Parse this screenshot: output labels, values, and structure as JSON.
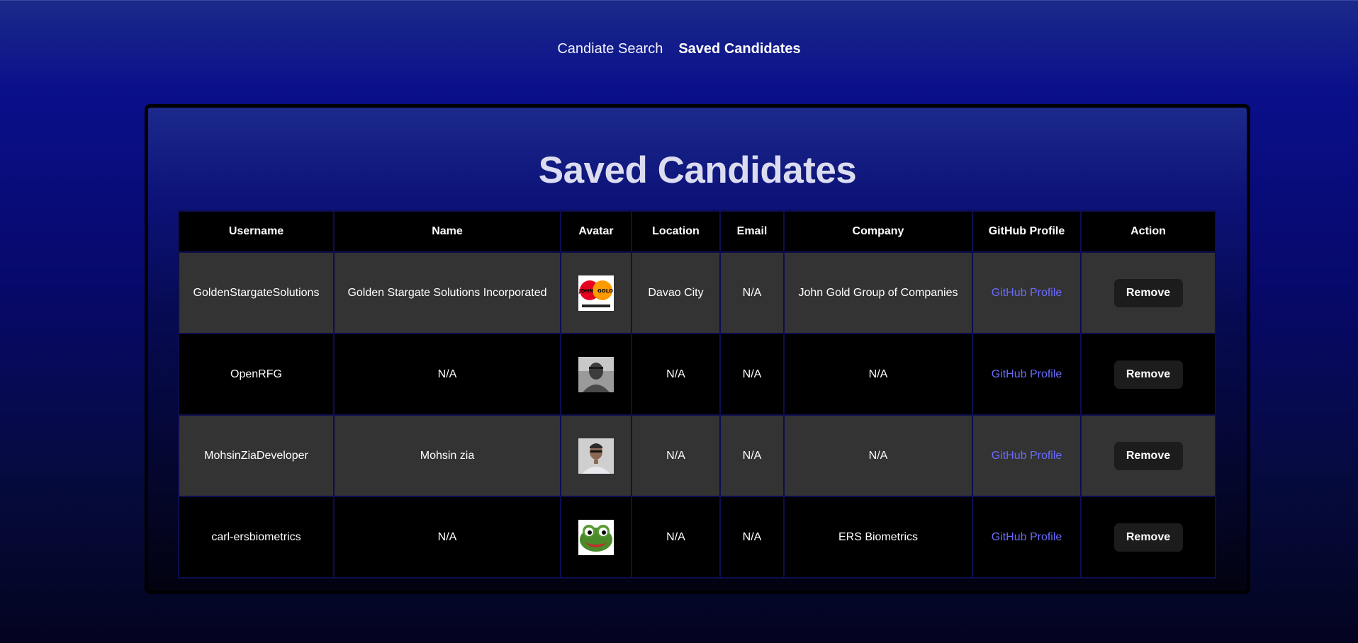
{
  "nav": {
    "search_label": "Candiate Search",
    "saved_label": "Saved Candidates"
  },
  "page": {
    "title": "Saved Candidates"
  },
  "table": {
    "headers": {
      "username": "Username",
      "name": "Name",
      "avatar": "Avatar",
      "location": "Location",
      "email": "Email",
      "company": "Company",
      "github": "GitHub Profile",
      "action": "Action"
    },
    "rows": [
      {
        "username": "GoldenStargateSolutions",
        "name": "Golden Stargate Solutions Incorporated",
        "avatar_icon": "john-gold-logo-avatar",
        "location": "Davao City",
        "email": "N/A",
        "company": "John Gold Group of Companies",
        "github_label": "GitHub Profile",
        "action_label": "Remove",
        "avatar_text_left": "JOHN",
        "avatar_text_right": "GOLD"
      },
      {
        "username": "OpenRFG",
        "name": "N/A",
        "avatar_icon": "person-photo-avatar",
        "location": "N/A",
        "email": "N/A",
        "company": "N/A",
        "github_label": "GitHub Profile",
        "action_label": "Remove"
      },
      {
        "username": "MohsinZiaDeveloper",
        "name": "Mohsin zia",
        "avatar_icon": "person-photo-avatar",
        "location": "N/A",
        "email": "N/A",
        "company": "N/A",
        "github_label": "GitHub Profile",
        "action_label": "Remove"
      },
      {
        "username": "carl-ersbiometrics",
        "name": "N/A",
        "avatar_icon": "frog-avatar",
        "location": "N/A",
        "email": "N/A",
        "company": "ERS Biometrics",
        "github_label": "GitHub Profile",
        "action_label": "Remove"
      }
    ]
  },
  "colors": {
    "link": "#6a6aff",
    "row_light": "#333333",
    "row_dark": "#000000",
    "button_bg": "#1c1c1c"
  }
}
